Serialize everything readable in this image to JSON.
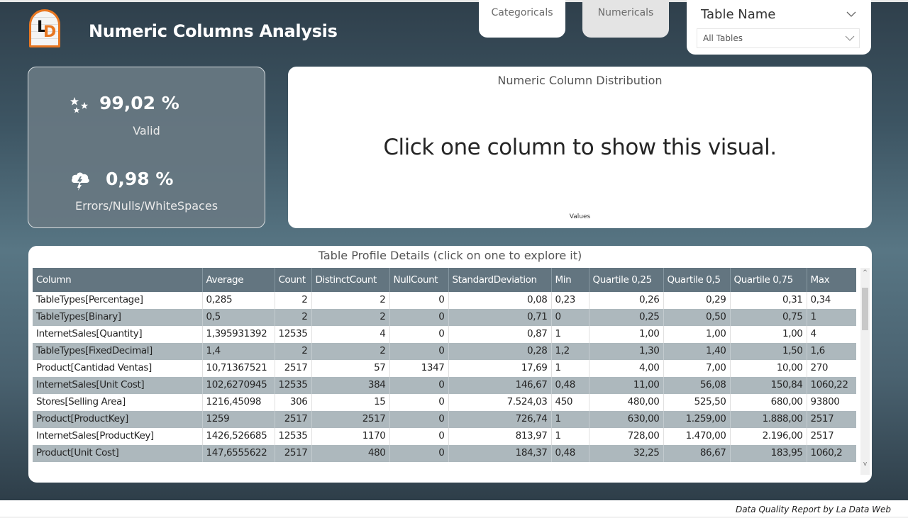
{
  "header": {
    "logo_letters": [
      "L",
      "D"
    ],
    "title": "Numeric Columns Analysis"
  },
  "tabs": [
    {
      "label": "Categoricals",
      "active": false
    },
    {
      "label": "Numericals",
      "active": true
    }
  ],
  "slicer": {
    "title": "Table Name",
    "selected": "All Tables"
  },
  "kpi": {
    "valid_value": "99,02 %",
    "valid_label": "Valid",
    "valid_icon": "sparkle-stars-icon",
    "errors_value": "0,98 %",
    "errors_label": "Errors/Nulls/WhiteSpaces",
    "errors_icon": "storm-cloud-icon"
  },
  "distribution": {
    "title": "Numeric Column Distribution",
    "message": "Click one column to show this visual.",
    "axis_label": "Values"
  },
  "profile_table": {
    "title": "Table Profile Details (click on one to explore it)",
    "columns": [
      "Column",
      "Average",
      "Count",
      "DistinctCount",
      "NullCount",
      "StandardDeviation",
      "Min",
      "Quartile 0,25",
      "Quartile 0,5",
      "Quartile 0,75",
      "Max"
    ],
    "rows": [
      [
        "TableTypes[Percentage]",
        "0,285",
        "2",
        "2",
        "0",
        "0,08",
        "0,23",
        "0,26",
        "0,29",
        "0,31",
        "0,34"
      ],
      [
        "TableTypes[Binary]",
        "0,5",
        "2",
        "2",
        "0",
        "0,71",
        "0",
        "0,25",
        "0,50",
        "0,75",
        "1"
      ],
      [
        "InternetSales[Quantity]",
        "1,395931392",
        "12535",
        "4",
        "0",
        "0,87",
        "1",
        "1,00",
        "1,00",
        "1,00",
        "4"
      ],
      [
        "TableTypes[FixedDecimal]",
        "1,4",
        "2",
        "2",
        "0",
        "0,28",
        "1,2",
        "1,30",
        "1,40",
        "1,50",
        "1,6"
      ],
      [
        "Product[Cantidad Ventas]",
        "10,71367521",
        "2517",
        "57",
        "1347",
        "17,69",
        "1",
        "4,00",
        "7,00",
        "10,00",
        "270"
      ],
      [
        "InternetSales[Unit Cost]",
        "102,6270945",
        "12535",
        "384",
        "0",
        "146,67",
        "0,48",
        "11,00",
        "56,08",
        "150,84",
        "1060,22"
      ],
      [
        "Stores[Selling Area]",
        "1216,45098",
        "306",
        "15",
        "0",
        "7.524,03",
        "450",
        "480,00",
        "525,50",
        "680,00",
        "93800"
      ],
      [
        "Product[ProductKey]",
        "1259",
        "2517",
        "2517",
        "0",
        "726,74",
        "1",
        "630,00",
        "1.259,00",
        "1.888,00",
        "2517"
      ],
      [
        "InternetSales[ProductKey]",
        "1426,526685",
        "12535",
        "1170",
        "0",
        "813,97",
        "1",
        "728,00",
        "1.470,00",
        "2.196,00",
        "2517"
      ],
      [
        "Product[Unit Cost]",
        "147,6555622",
        "2517",
        "480",
        "0",
        "184,37",
        "0,48",
        "32,25",
        "86,67",
        "183,95",
        "1060,2"
      ]
    ]
  },
  "footer": {
    "credit": "Data Quality Report by La Data Web"
  },
  "colors": {
    "accent_orange": "#e87722",
    "table_header": "#637580",
    "row_alt": "#adb8bd"
  }
}
